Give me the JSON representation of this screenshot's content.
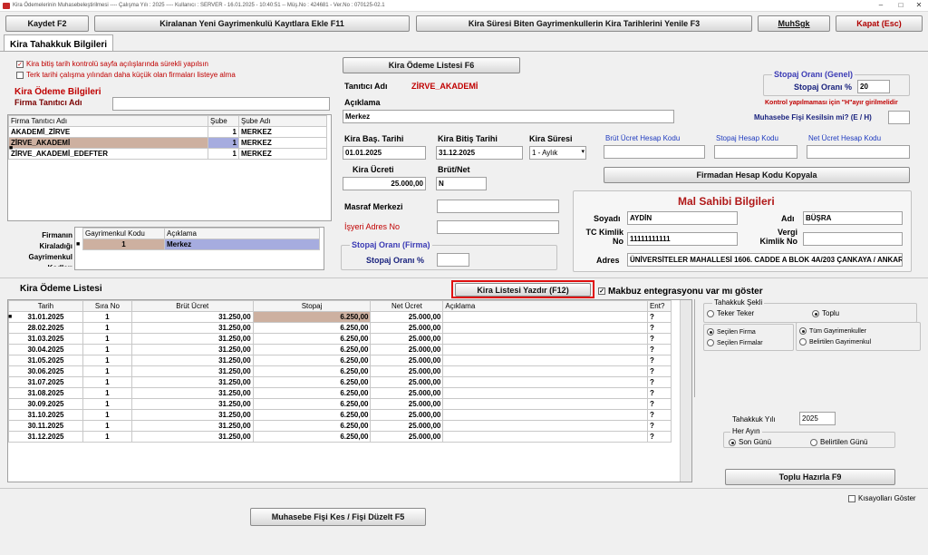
{
  "window": {
    "title": "Kira Ödemelerinin Muhasebeleştirilmesi  ----  Çalışma Yılı : 2025  ----  Kullanıcı : SERVER  - 16.01.2025 - 10:40:51  --  Müş.No : 424681  - Ver.No : 070125-02.1"
  },
  "toolbar": {
    "save": "Kaydet F2",
    "add": "Kiralanan Yeni Gayrimenkulü Kayıtlara Ekle F11",
    "renew": "Kira Süresi Biten Gayrimenkullerin Kira Tarihlerini Yenile F3",
    "muhsgk": "MuhSgk",
    "close": "Kapat (Esc)"
  },
  "tab": {
    "label": "Kira Tahakkuk Bilgileri"
  },
  "left": {
    "chk1": "Kira bitiş tarih kontrolü sayfa açılışlarında sürekli yapılsın",
    "chk2": "Terk tarihi çalışma yılından daha küçük olan firmaları listeye alma",
    "section_title": "Kira Ödeme Bilgileri",
    "firm_label": "Firma Tanıtıcı Adı",
    "firm_value": "",
    "table_headers": [
      "Firma Tanıtıcı Adı",
      "Şube",
      "Şube Adı"
    ],
    "rows": [
      [
        "AKADEMİ_ZİRVE",
        "1",
        "MERKEZ"
      ],
      [
        "ZİRVE_AKADEMİ",
        "1",
        "MERKEZ"
      ],
      [
        "ZİRVE_AKADEMİ_EDEFTER",
        "1",
        "MERKEZ"
      ]
    ],
    "firm_side_label": "Firmanın Kiraladığı Gayrimenkul Kodları",
    "prop_headers": [
      "Gayrimenkul Kodu",
      "Açıklama"
    ],
    "prop_row": [
      "1",
      "Merkez"
    ]
  },
  "mid": {
    "list_button": "Kira Ödeme Listesi F6",
    "tanitici_label": "Tanıtıcı Adı",
    "tanitici_value": "ZİRVE_AKADEMİ",
    "aciklama_label": "Açıklama",
    "aciklama_value": "Merkez",
    "bas_label": "Kira Baş. Tarihi",
    "bas_value": "01.01.2025",
    "bit_label": "Kira Bitiş Tarihi",
    "bit_value": "31.12.2025",
    "sure_label": "Kira Süresi",
    "sure_value": "1 - Aylık",
    "ucret_label": "Kira Ücreti",
    "ucret_value": "25.000,00",
    "brutnet_label": "Brüt/Net",
    "brutnet_value": "N",
    "masraf_label": "Masraf Merkezi",
    "isyeri_label": "İşyeri Adres No",
    "stopaj_firma_title": "Stopaj Oranı (Firma)",
    "stopaj_firma_label": "Stopaj Oranı %"
  },
  "right": {
    "stopaj_genel_title": "Stopaj Oranı (Genel)",
    "stopaj_genel_label": "Stopaj Oranı %",
    "stopaj_genel_value": "20",
    "kontrol_note": "Kontrol yapılmaması için \"H\"ayır girilmelidir",
    "muh_fis_label": "Muhasebe Fişi Kesilsin mi? (E / H)",
    "brut_kod": "Brüt Ücret Hesap Kodu",
    "stopaj_kod": "Stopaj Hesap Kodu",
    "net_kod": "Net Ücret Hesap Kodu",
    "copy_button": "Firmadan Hesap Kodu Kopyala",
    "owner_title": "Mal Sahibi Bilgileri",
    "soyadi_label": "Soyadı",
    "soyadi_value": "AYDİN",
    "adi_label": "Adı",
    "adi_value": "BÜŞRA",
    "tc_label": "TC Kimlik No",
    "tc_value": "11111111111",
    "vergi_label": "Vergi Kimlik No",
    "adres_label": "Adres",
    "adres_value": "ÜNİVERSİTELER MAHALLESİ 1606. CADDE A BLOK 4A/203 ÇANKAYA / ANKARA"
  },
  "list": {
    "title": "Kira Ödeme Listesi",
    "print_button": "Kira Listesi Yazdır (F12)",
    "makbuz_label": "Makbuz entegrasyonu var mı göster",
    "headers": [
      "Tarih",
      "Sıra No",
      "Brüt Ücret",
      "Stopaj",
      "Net Ücret",
      "Açıklama",
      "Ent?"
    ],
    "rows": [
      [
        "31.01.2025",
        "1",
        "31.250,00",
        "6.250,00",
        "25.000,00",
        "",
        "?"
      ],
      [
        "28.02.2025",
        "1",
        "31.250,00",
        "6.250,00",
        "25.000,00",
        "",
        "?"
      ],
      [
        "31.03.2025",
        "1",
        "31.250,00",
        "6.250,00",
        "25.000,00",
        "",
        "?"
      ],
      [
        "30.04.2025",
        "1",
        "31.250,00",
        "6.250,00",
        "25.000,00",
        "",
        "?"
      ],
      [
        "31.05.2025",
        "1",
        "31.250,00",
        "6.250,00",
        "25.000,00",
        "",
        "?"
      ],
      [
        "30.06.2025",
        "1",
        "31.250,00",
        "6.250,00",
        "25.000,00",
        "",
        "?"
      ],
      [
        "31.07.2025",
        "1",
        "31.250,00",
        "6.250,00",
        "25.000,00",
        "",
        "?"
      ],
      [
        "31.08.2025",
        "1",
        "31.250,00",
        "6.250,00",
        "25.000,00",
        "",
        "?"
      ],
      [
        "30.09.2025",
        "1",
        "31.250,00",
        "6.250,00",
        "25.000,00",
        "",
        "?"
      ],
      [
        "31.10.2025",
        "1",
        "31.250,00",
        "6.250,00",
        "25.000,00",
        "",
        "?"
      ],
      [
        "30.11.2025",
        "1",
        "31.250,00",
        "6.250,00",
        "25.000,00",
        "",
        "?"
      ],
      [
        "31.12.2025",
        "1",
        "31.250,00",
        "6.250,00",
        "25.000,00",
        "",
        "?"
      ]
    ]
  },
  "tahakkuk": {
    "sekli_title": "Tahakkuk Şekli",
    "teker": "Teker Teker",
    "toplu": "Toplu",
    "secilen_firma": "Seçilen Firma",
    "secilen_firmalar": "Seçilen Firmalar",
    "tum_gayrimenkul": "Tüm Gayrimenkuller",
    "belirtilen_gayrimenkul": "Belirtilen Gayrimenkul",
    "yil_label": "Tahakkuk Yılı",
    "yil_value": "2025",
    "her_ayin": "Her Ayın",
    "son_gunu": "Son Günü",
    "belirtilen_gun": "Belirtilen Günü",
    "toplu_button": "Toplu Hazırla F9",
    "kisayol": "Kısayolları Göster"
  },
  "bottom": {
    "muh_button": "Muhasebe Fişi Kes / Fişi Düzelt F5"
  }
}
